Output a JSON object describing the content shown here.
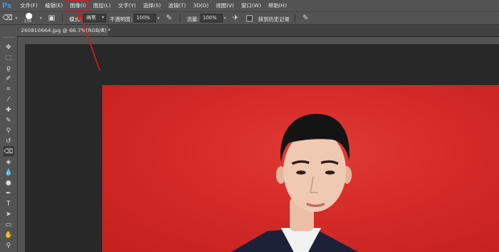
{
  "app": {
    "logo": "Ps"
  },
  "menu": [
    "文件(F)",
    "编辑(E)",
    "图像(I)",
    "图层(L)",
    "文字(Y)",
    "选择(S)",
    "滤镜(T)",
    "3D(D)",
    "视图(V)",
    "窗口(W)",
    "帮助(H)"
  ],
  "highlighted_menu": "图像(I)",
  "options": {
    "brush_size": "134",
    "mode_label": "模式:",
    "mode_value": "画笔",
    "opacity_label": "不透明度:",
    "opacity_value": "100%",
    "flow_label": "流量:",
    "flow_value": "100%",
    "history_label": "抹到历史记录"
  },
  "document": {
    "tab_title": "260810664.jpg @ 66.7%(RGB/8) *",
    "close_glyph": "×"
  },
  "tools": [
    "move-tool",
    "marquee-tool",
    "lasso-tool",
    "quick-select-tool",
    "crop-tool",
    "eyedropper-tool",
    "healing-brush-tool",
    "brush-tool",
    "clone-stamp-tool",
    "history-brush-tool",
    "eraser-tool",
    "paint-bucket-tool",
    "blur-tool",
    "dodge-tool",
    "pen-tool",
    "type-tool",
    "path-select-tool",
    "rectangle-tool",
    "hand-tool",
    "zoom-tool"
  ],
  "active_tool": "eraser-tool",
  "colors": {
    "highlight": "#d21d1d",
    "photo_bg": "#d42a28",
    "arrow": "#cc1f1f"
  }
}
